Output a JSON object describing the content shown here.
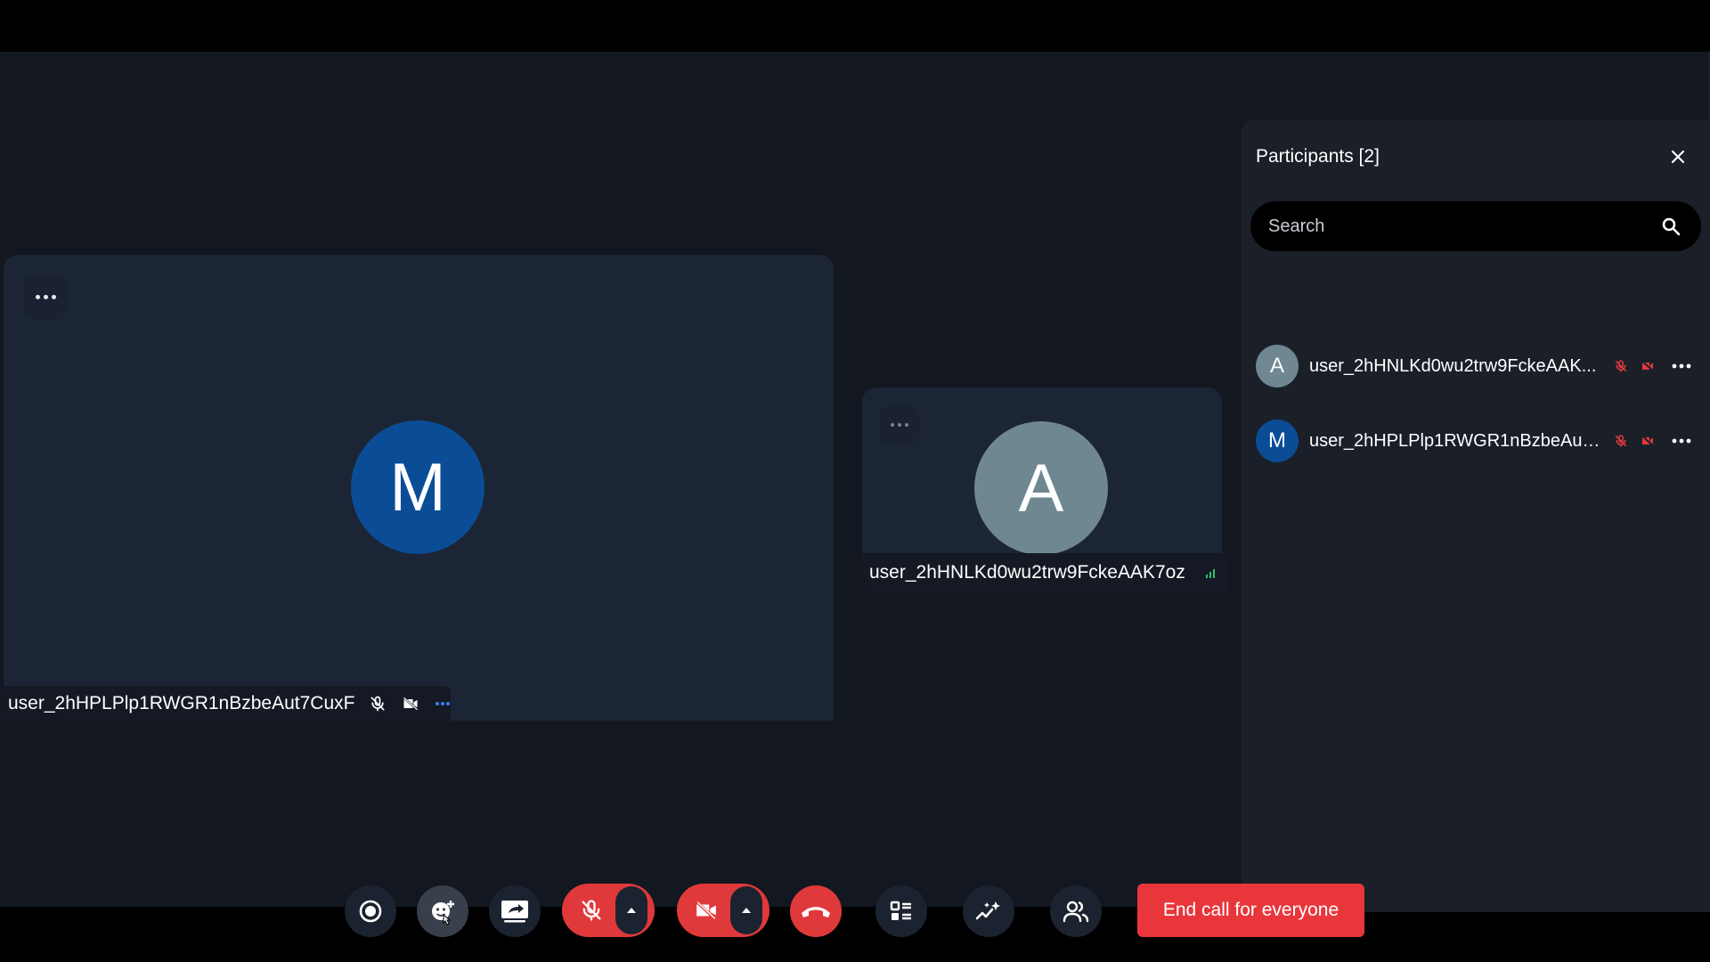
{
  "main_tile": {
    "initial": "M",
    "name": "user_2hHPLPlp1RWGR1nBzbeAut7CuxF",
    "avatar_color": "#0a4d96"
  },
  "side_tile": {
    "initial": "A",
    "name": "user_2hHNLKd0wu2trw9FckeAAK7oz",
    "avatar_color": "#6f8790"
  },
  "panel": {
    "title": "Participants [2]",
    "search_placeholder": "Search",
    "participants": [
      {
        "initial": "A",
        "name": "user_2hHNLKd0wu2trw9FckeAAK...",
        "avatar_color": "#6f8790"
      },
      {
        "initial": "M",
        "name": "user_2hHPLPlp1RWGR1nBzbeAut7...",
        "avatar_color": "#0a4d96"
      }
    ]
  },
  "toolbar": {
    "end_all_label": "End call for everyone"
  },
  "colors": {
    "danger": "#e0393b",
    "signal": "#2bc26a",
    "background": "#121720"
  }
}
